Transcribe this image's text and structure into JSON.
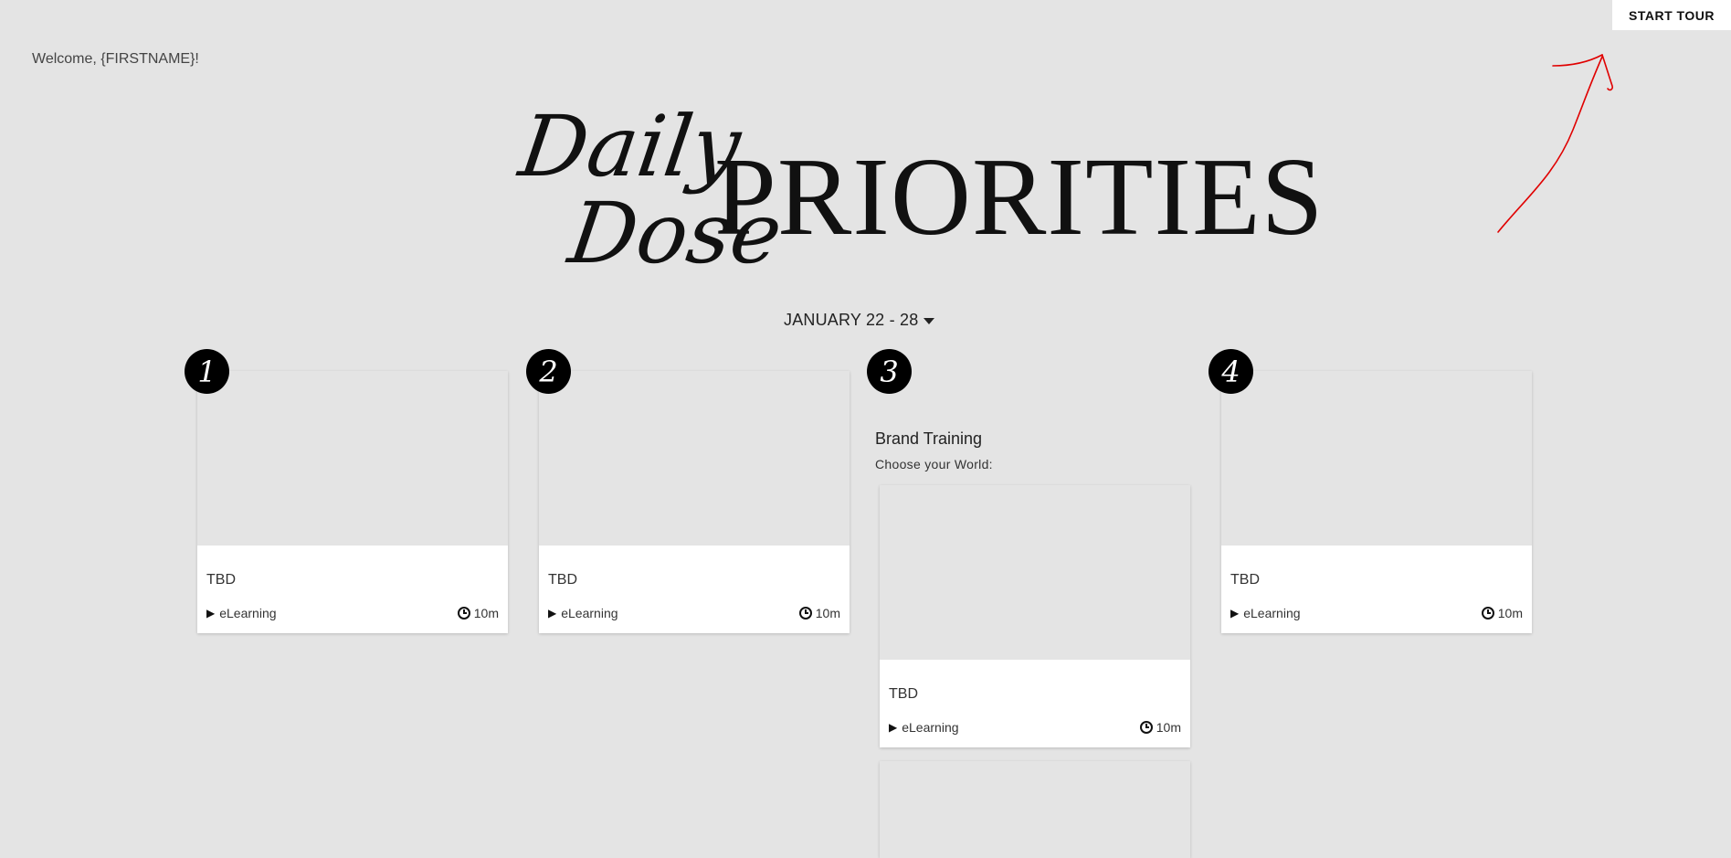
{
  "header": {
    "welcome": "Welcome, {FIRSTNAME}!",
    "start_tour": "START TOUR"
  },
  "brand": {
    "script_line_1": "Daily",
    "script_line_2": "Dose",
    "main": "PRIORITIES"
  },
  "date_range": {
    "label": "JANUARY 22 - 28"
  },
  "priorities": [
    {
      "number": "1",
      "card": {
        "title": "TBD",
        "type": "eLearning",
        "duration": "10m"
      }
    },
    {
      "number": "2",
      "card": {
        "title": "TBD",
        "type": "eLearning",
        "duration": "10m"
      }
    },
    {
      "number": "3",
      "section_title": "Brand Training",
      "section_subtitle": "Choose your World:",
      "card": {
        "title": "TBD",
        "type": "eLearning",
        "duration": "10m"
      }
    },
    {
      "number": "4",
      "card": {
        "title": "TBD",
        "type": "eLearning",
        "duration": "10m"
      }
    }
  ],
  "colors": {
    "background": "#e4e4e4",
    "badge": "#000000",
    "annotation": "#e00000"
  },
  "icons": {
    "type": "play-icon",
    "duration": "clock-icon",
    "date_dropdown": "caret-down-icon"
  }
}
